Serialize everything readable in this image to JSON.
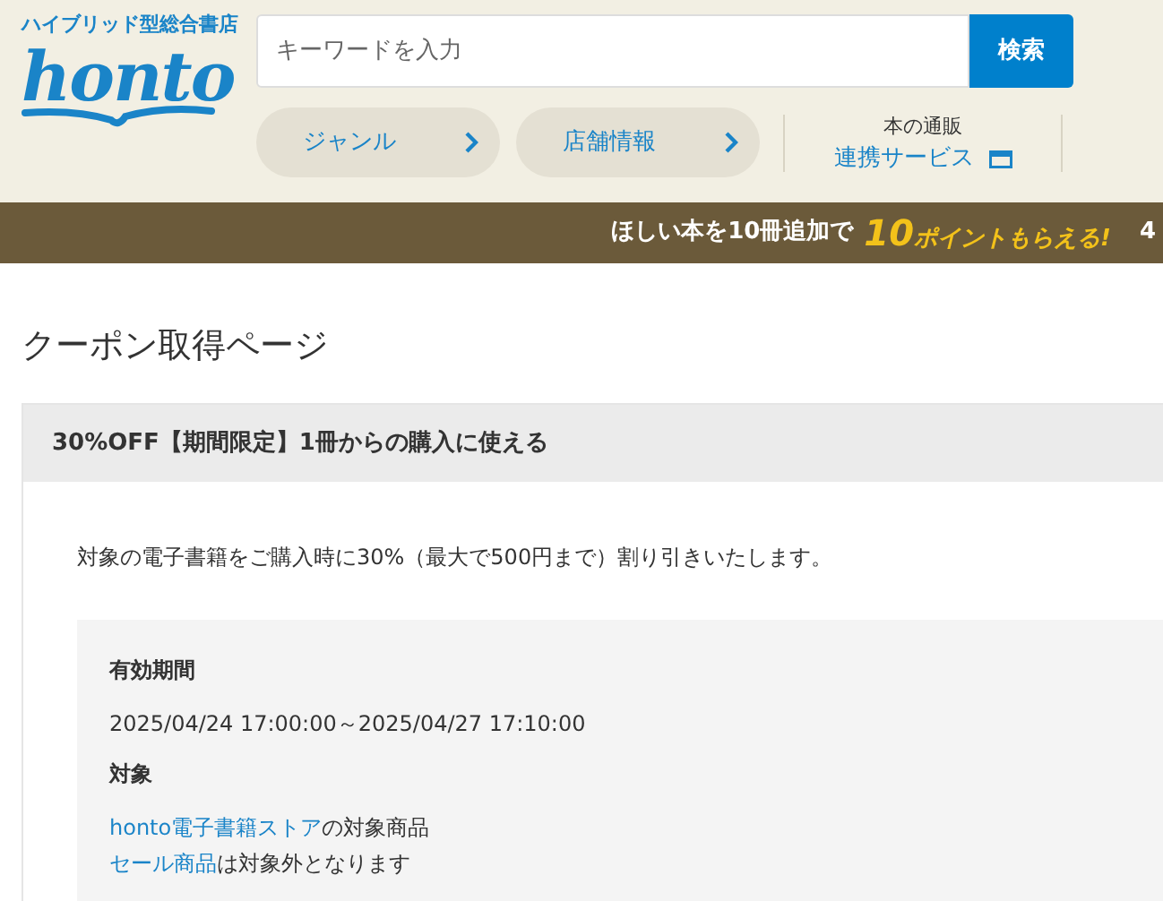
{
  "header": {
    "tagline": "ハイブリッド型総合書店",
    "logo": "honto",
    "search": {
      "placeholder": "キーワードを入力",
      "button": "検索"
    },
    "nav": [
      {
        "label": "ジャンル"
      },
      {
        "label": "店舗情報"
      }
    ],
    "service": {
      "line_1": "本の通販",
      "line_2": "連携サービス"
    }
  },
  "banner": {
    "lead": "ほしい本を10冊追加で",
    "number": "10",
    "suffix": "ポイントもらえる!",
    "tail": "4"
  },
  "page_title": "クーポン取得ページ",
  "coupon": {
    "title": "30%OFF【期間限定】1冊からの購入に使える",
    "description": "対象の電子書籍をご購入時に30%（最大で500円まで）割り引きいたします。",
    "details": [
      {
        "kind": "text",
        "heading": "有効期間",
        "lines": [
          {
            "text": "2025/04/24 17:00:00～2025/04/27 17:10:00"
          }
        ]
      },
      {
        "kind": "links",
        "heading": "対象",
        "lines": [
          {
            "link": "honto電子書籍ストア",
            "text": "の対象商品"
          },
          {
            "link": "セール商品",
            "text": "は対象外となります"
          }
        ]
      }
    ]
  }
}
